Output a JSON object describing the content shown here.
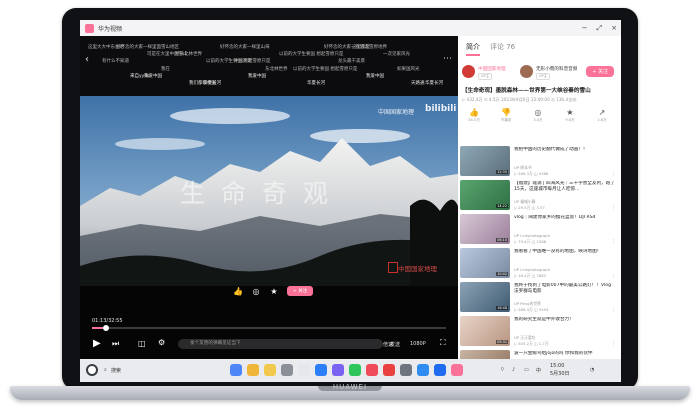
{
  "laptop": {
    "brand": "HUAWEI"
  },
  "window": {
    "app_title": "华为视频",
    "min": "−",
    "restore": "⤢",
    "close": "×"
  },
  "danmaku": [
    {
      "text": "这里大大中东古达",
      "bright": false
    },
    {
      "text": "可是在大里中国雪山",
      "bright": false
    },
    {
      "text": "以前的大学生要国 想起雪原只是",
      "bright": false
    },
    {
      "text": "东北林世界",
      "bright": false
    },
    {
      "text": "好怀念的大家一样思念雪原地界",
      "bright": false
    },
    {
      "text": "一次见家风光",
      "bright": false
    },
    {
      "text": "有什么不知道",
      "bright": false
    },
    {
      "text": "我在",
      "bright": false
    },
    {
      "text": "好怀念的大家一样里山海",
      "bright": false
    },
    {
      "text": "以前的大学生要国 想起雪原只是",
      "bright": false
    },
    {
      "text": "龙头最干美景",
      "bright": false
    },
    {
      "text": "如果国风光",
      "bright": false
    },
    {
      "text": "好怀念的大家一样里面雪山地区",
      "bright": false
    },
    {
      "text": "时长北林世界",
      "bright": false
    },
    {
      "text": "中国风景",
      "bright": false
    },
    {
      "text": "以前的大学生要国 想起雪原只是",
      "bright": false
    },
    {
      "text": "这里都是",
      "bright": false
    },
    {
      "text": "天路通",
      "bright": true
    },
    {
      "text": "来自yyds",
      "bright": true
    },
    {
      "text": "我们都很中国",
      "bright": true
    },
    {
      "text": "我爱中国",
      "bright": true
    },
    {
      "text": "华夏长河",
      "bright": true
    },
    {
      "text": "我爱中国",
      "bright": true
    },
    {
      "text": "华夏长河",
      "bright": true
    },
    {
      "text": "我爱中国",
      "bright": true
    },
    {
      "text": "华夏长河",
      "bright": true
    }
  ],
  "video": {
    "watermark": "中国国家地理",
    "bili_logo": "bilibili",
    "big_title": "生命奇观",
    "stamp_text": "中国国家地理",
    "follow_label": "+ 关注",
    "time": "01:13/32:55",
    "progress": 0.04,
    "danmaku_placeholder": "发个友善的弹幕见证当下",
    "speed_label": "倍速",
    "quality_label": "1080P"
  },
  "panel": {
    "tabs": [
      {
        "label": "简介"
      },
      {
        "label": "评论 76"
      }
    ],
    "author1": {
      "name": "中国国家地理",
      "tag": "UP主"
    },
    "author2": {
      "name": "无形小而的科普音频",
      "tag": "UP主"
    },
    "follow": "+ 关注",
    "video_title": "【生命奇观】墨脱森林——世界第一大峡谷秦的雪山",
    "stats": "▷ 432.4万  ⊙ 4.5万  2023年9月6日 22:00:00  ◎ 136.4全站",
    "actions": [
      {
        "icon": "👍",
        "label": "34.3万"
      },
      {
        "icon": "👎",
        "label": "不喜欢"
      },
      {
        "icon": "◎",
        "label": "3.4万"
      },
      {
        "icon": "★",
        "label": "9.6万"
      },
      {
        "icon": "↗",
        "label": "2.6万"
      }
    ],
    "recs": [
      {
        "title": "我把中国的历史翻代做成了动画！！",
        "up": "UP 原本书",
        "stats": "▷ 269.3万  ◫ 4388",
        "dur": "12:35",
        "colors": [
          "#8fa9b7",
          "#5b6e7a"
        ]
      },
      {
        "title": "【福建】霞浦 | 四海风光｜三千字善全友利，跑了15天，这座城市每月让人吃惊...",
        "up": "UP 福城小静",
        "stats": "▷ 29.5万  ◫ 3.57",
        "dur": "14:22",
        "colors": [
          "#59a56f",
          "#2f6f44"
        ]
      },
      {
        "title": "vlog｜阔建你家乡的樱花盆景！DJI RS4",
        "up": "UP Linkphotograph",
        "stats": "▷ 79.4万  ◫ 1588",
        "dur": "06:10",
        "colors": [
          "#d7c8d6",
          "#9b7f9a"
        ]
      },
      {
        "title": "我看看了中国唯一没有的地图，峡湾地图！",
        "up": "UP Linkphotograph",
        "stats": "▷ 18.4万  ◫ 7882",
        "dur": "10:02",
        "colors": [
          "#b8c9de",
          "#7a8aa1"
        ]
      },
      {
        "title": "我终于找到了电影007中的最美公路灯！！Vlog 法罗群岛电影",
        "up": "UP Peng的世界",
        "stats": "▷ 286.4万  ◫ 3454",
        "dur": "16:48",
        "colors": [
          "#8da3b6",
          "#3e5a70"
        ]
      },
      {
        "title": "我的研究生就是中外收合力！",
        "up": "UP 汪汪爱吃",
        "stats": "▷ 505.2万  ◫ 1.7万",
        "dur": "05:31",
        "colors": [
          "#e7d4c7",
          "#b99582"
        ]
      },
      {
        "title": "波一只金鲸鸟给jojo的吗 你和我的伙伴",
        "up": "UP 狐小乐",
        "stats": "▷ 3.2万  ◫ 73",
        "dur": "02:14",
        "colors": [
          "#c9b4a3",
          "#8a6e58"
        ]
      }
    ]
  },
  "taskbar": {
    "search_label": "搜索",
    "ime": "中",
    "time": "15:00",
    "date": "5月30日",
    "icons": [
      {
        "name": "launcher-icon",
        "color": "#4e86f7"
      },
      {
        "name": "files-icon",
        "color": "#f0b63a"
      },
      {
        "name": "notes-icon",
        "color": "#f2c94c"
      },
      {
        "name": "doc-icon",
        "color": "#8b8f97"
      },
      {
        "name": "calendar-icon",
        "color": "#e5e7ea"
      },
      {
        "name": "mail-icon",
        "color": "#2d7ff9"
      },
      {
        "name": "app-icon",
        "color": "#7a63f2"
      },
      {
        "name": "chat-icon",
        "color": "#2ec65a"
      },
      {
        "name": "music-icon",
        "color": "#f04a5a"
      },
      {
        "name": "video-icon",
        "color": "#e8413f"
      },
      {
        "name": "settings-icon",
        "color": "#6f7580"
      },
      {
        "name": "weather-icon",
        "color": "#2f8cf0"
      },
      {
        "name": "huawei-video-icon",
        "color": "#1f6cf2"
      },
      {
        "name": "bilibili-icon",
        "color": "#fb7299"
      }
    ]
  }
}
